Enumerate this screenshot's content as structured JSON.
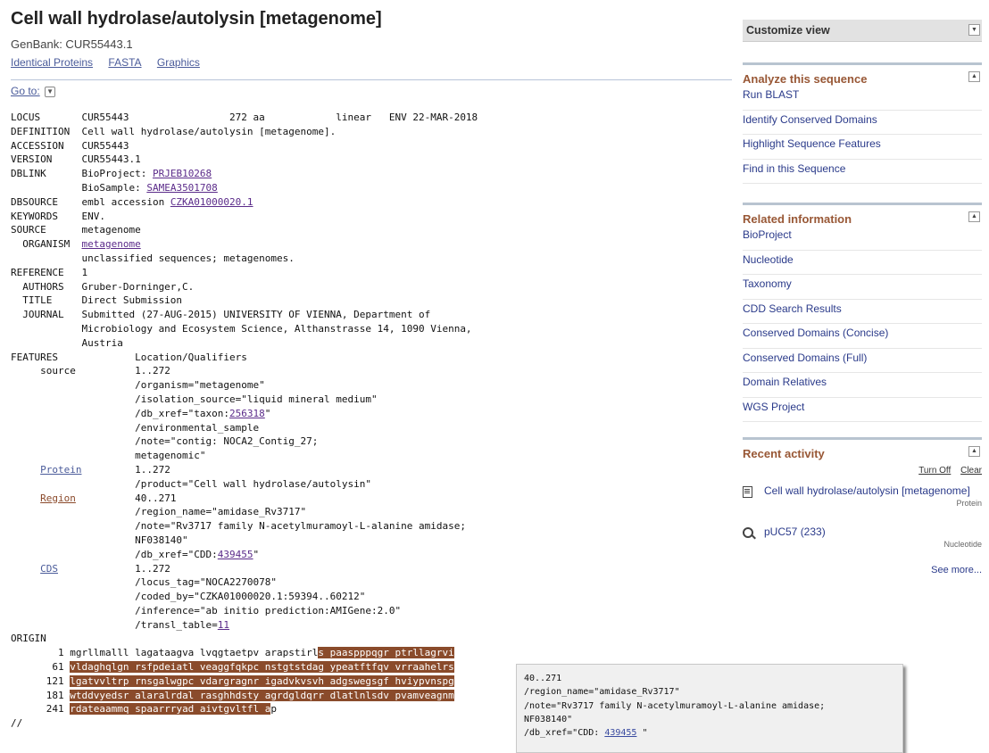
{
  "page": {
    "title": "Cell wall hydrolase/autolysin [metagenome]",
    "accession_line": "GenBank: CUR55443.1",
    "links": [
      "Identical Proteins",
      "FASTA",
      "Graphics"
    ],
    "goto_label": "Go to:"
  },
  "genbank": {
    "locus": [
      "LOCUS       CUR55443                 272 aa            linear   ENV 22-MAR-2018"
    ],
    "definition": "DEFINITION  Cell wall hydrolase/autolysin [metagenome].",
    "accession": "ACCESSION   CUR55443",
    "version": "VERSION     CUR55443.1",
    "dblink_prefix": "DBLINK      BioProject: ",
    "bioproject": "PRJEB10268",
    "biosample_prefix": "            BioSample: ",
    "biosample": "SAMEA3501708",
    "dbsource_prefix": "DBSOURCE    embl accession ",
    "dbsource_link": "CZKA01000020.1",
    "keywords": "KEYWORDS    ENV.",
    "source": "SOURCE      metagenome",
    "organism_prefix": "  ORGANISM  ",
    "organism_link": "metagenome",
    "lineage": "            unclassified sequences; metagenomes.",
    "reference": "REFERENCE   1",
    "authors": "  AUTHORS   Gruber-Dorninger,C.",
    "ref_title": "  TITLE     Direct Submission",
    "journal1": "  JOURNAL   Submitted (27-AUG-2015) UNIVERSITY OF VIENNA, Department of",
    "journal2": "            Microbiology and Ecosystem Science, Althanstrasse 14, 1090 Vienna,",
    "journal3": "            Austria",
    "features": "FEATURES             Location/Qualifiers",
    "source_feat": "source",
    "src1": "          1..272",
    "src2": "                     /organism=\"metagenome\"",
    "src3": "                     /isolation_source=\"liquid mineral medium\"",
    "src4_prefix": "                     /db_xref=\"taxon:",
    "src4_link": "256318",
    "src5": "                     /environmental_sample",
    "src6": "                     /note=\"contig: NOCA2_Contig_27;",
    "src7": "                     metagenomic\"",
    "protein_feat": "Protein",
    "prot1": "         1..272",
    "prot2": "                     /product=\"Cell wall hydrolase/autolysin\"",
    "region_feat": "Region",
    "reg1": "          40..271",
    "reg2": "                     /region_name=\"amidase_Rv3717\"",
    "reg3": "                     /note=\"Rv3717 family N-acetylmuramoyl-L-alanine amidase;",
    "reg4": "                     NF038140\"",
    "reg5_prefix": "                     /db_xref=\"CDD:",
    "reg5_link": "439455",
    "cds_feat": "CDS",
    "cds1": "             1..272",
    "cds2": "                     /locus_tag=\"NOCA2270078\"",
    "cds3": "                     /coded_by=\"CZKA01000020.1:59394..60212\"",
    "cds4": "                     /inference=\"ab initio prediction:AMIGene:2.0\"",
    "cds5_prefix": "                     /transl_table=",
    "cds5_link": "11",
    "origin": "ORIGIN",
    "seq1_num": "        1 ",
    "seq1_plain": "mgrllmalll lagataagva lvqgtaetpv arapstirl",
    "seq1_hl": "s paaspppqgr ptrllagrvi",
    "seq2_num": "       61 ",
    "seq2_hl": "vldaghqlgn rsfpdeiatl veaggfqkpc nstgtstdag ypeatftfqv vrraahelrs",
    "seq3_num": "      121 ",
    "seq3_hl": "lgatvvltrp rnsgalwgpc vdargragnr igadvkvsvh adgswegsgf hviypvnspg",
    "seq4_num": "      181 ",
    "seq4_hl": "wtddvyedsr alaralrdal rasghhdsty agrdgldqrr dlatlnlsdv pvamveagnm",
    "seq5_num": "      241 ",
    "seq5_hl": "rdateaammq spaarrryad aivtgvltfl a",
    "seq5_plain": "p",
    "end": "//"
  },
  "tooltip": {
    "l1": "40..271",
    "l2": "/region_name=\"amidase_Rv3717\"",
    "l3": "/note=\"Rv3717 family N-acetylmuramoyl-L-alanine amidase;",
    "l4": "NF038140\"",
    "l5_prefix": "/db_xref=\"CDD: ",
    "l5_link": "439455",
    "l5_suffix": " \""
  },
  "sidebar": {
    "customize": "Customize view",
    "analyze": {
      "title": "Analyze this sequence",
      "items": [
        "Run BLAST",
        "Identify Conserved Domains",
        "Highlight Sequence Features",
        "Find in this Sequence"
      ]
    },
    "related": {
      "title": "Related information",
      "items": [
        "BioProject",
        "Nucleotide",
        "Taxonomy",
        "CDD Search Results",
        "Conserved Domains (Concise)",
        "Conserved Domains (Full)",
        "Domain Relatives",
        "WGS Project"
      ]
    },
    "recent": {
      "title": "Recent activity",
      "turn_off": "Turn Off",
      "clear": "Clear",
      "items": [
        {
          "label": "Cell wall hydrolase/autolysin [metagenome]",
          "db": "Protein",
          "icon": "document-icon"
        },
        {
          "label": "pUC57 (233)",
          "db": "Nucleotide",
          "icon": "search-icon"
        }
      ],
      "see_more": "See more..."
    }
  }
}
